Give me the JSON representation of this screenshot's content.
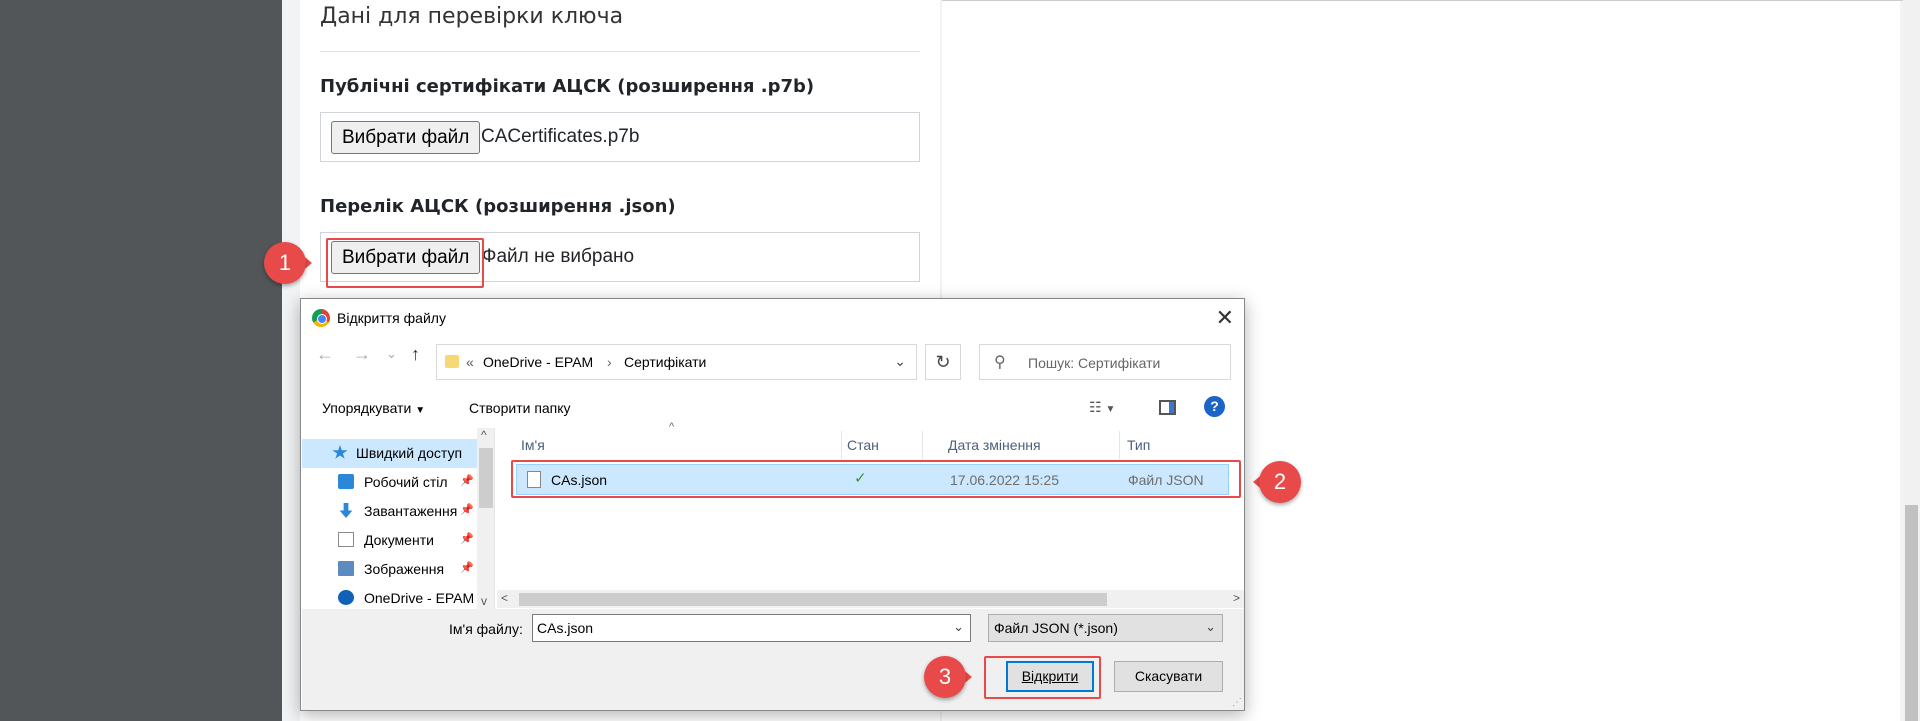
{
  "page": {
    "section_title": "Дані для перевірки ключа",
    "field1": {
      "label": "Публічні сертифікати АЦСК (розширення .p7b)",
      "button": "Вибрати файл",
      "file_name": "CACertificates.p7b"
    },
    "field2": {
      "label": "Перелік АЦСК (розширення .json)",
      "button": "Вибрати файл",
      "file_name": "Файл не вибрано"
    }
  },
  "dialog": {
    "title": "Відкриття файлу",
    "close_glyph": "✕",
    "nav": {
      "back": "←",
      "forward": "→",
      "recent": "⌄",
      "up": "↑"
    },
    "path": {
      "prefix": "«",
      "segments": [
        "OneDrive - EPAM",
        "Сертифікати"
      ],
      "separator": "›",
      "dropdown": "⌄"
    },
    "refresh_glyph": "↻",
    "search_placeholder": "Пошук: Сертифікати",
    "toolbar": {
      "organize": "Упорядкувати",
      "new_folder": "Створити папку",
      "help": "?"
    },
    "nav_pane": [
      {
        "label": "Швидкий доступ",
        "icon": "star-icon",
        "color": "#2b88d8",
        "pinned": false,
        "selected": true
      },
      {
        "label": "Робочий стіл",
        "icon": "desktop-icon",
        "color": "#2b88d8",
        "pinned": true,
        "selected": false
      },
      {
        "label": "Завантаження",
        "icon": "download-icon",
        "color": "#2b88d8",
        "pinned": true,
        "selected": false
      },
      {
        "label": "Документи",
        "icon": "document-icon",
        "color": "#8a8a8a",
        "pinned": true,
        "selected": false
      },
      {
        "label": "Зображення",
        "icon": "image-icon",
        "color": "#5b8bbf",
        "pinned": true,
        "selected": false
      },
      {
        "label": "OneDrive - EPAM",
        "icon": "cloud-icon",
        "color": "#0f62b8",
        "pinned": false,
        "selected": false
      }
    ],
    "columns": {
      "name": "Ім'я",
      "state": "Стан",
      "date": "Дата змінення",
      "type": "Тип"
    },
    "files": [
      {
        "name": "CAs.json",
        "state_icon": "check-circle-icon",
        "date": "17.06.2022 15:25",
        "type": "Файл JSON",
        "selected": true
      }
    ],
    "file_name_label": "Ім'я файлу:",
    "file_name_value": "CAs.json",
    "file_type": "Файл JSON (*.json)",
    "open_button": "Відкрити",
    "cancel_button": "Скасувати"
  },
  "annotations": {
    "markers": [
      "1",
      "2",
      "3"
    ],
    "color": "#e84a4a"
  }
}
